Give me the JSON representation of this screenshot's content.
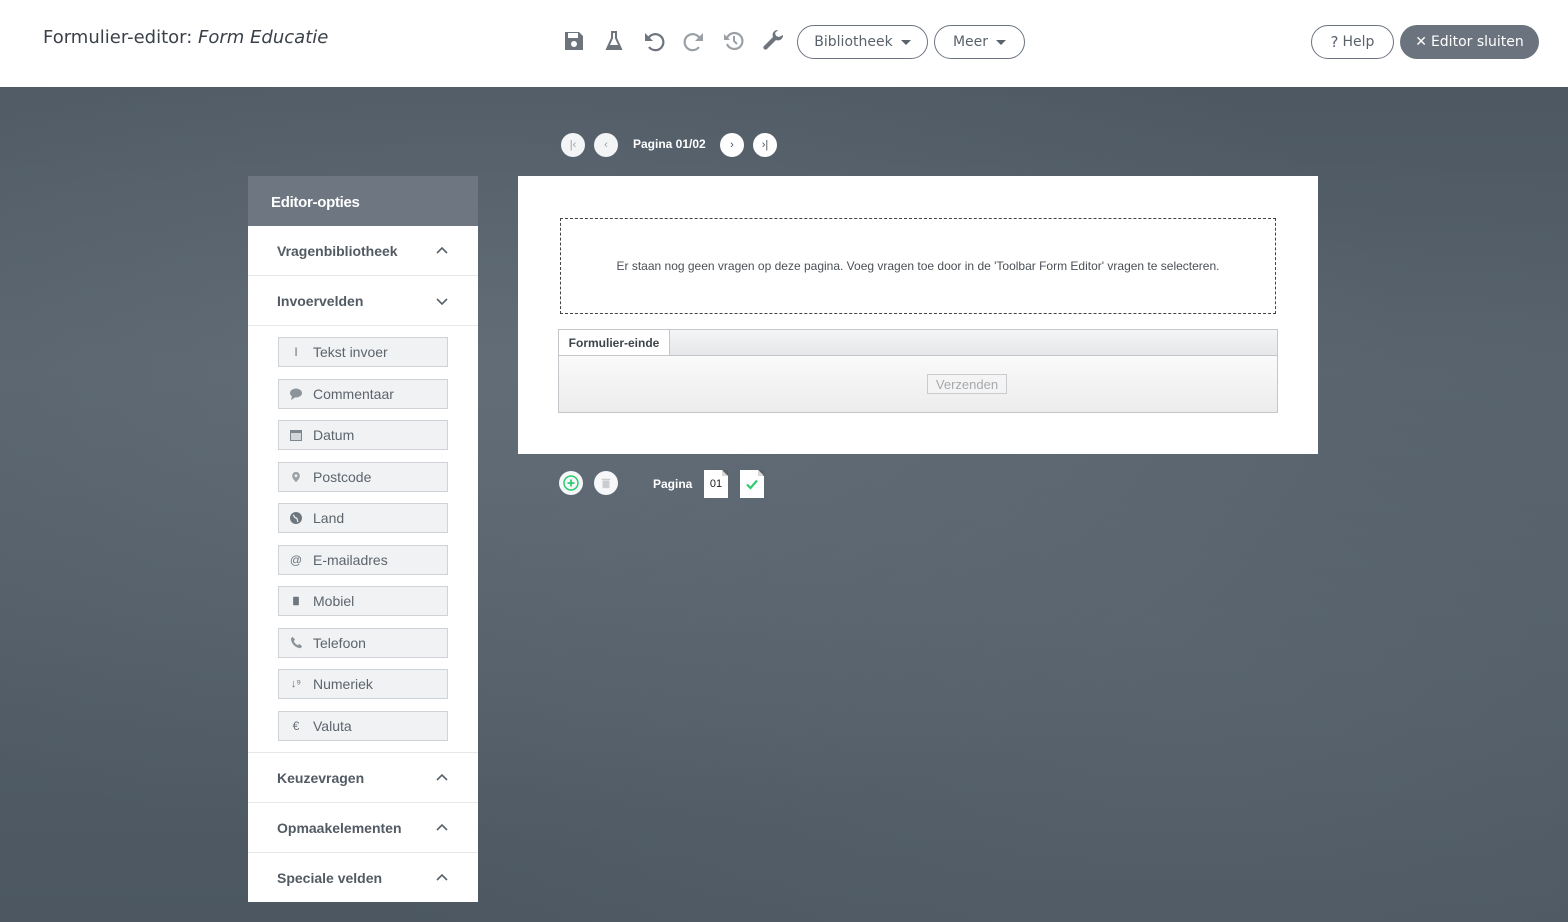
{
  "header": {
    "title_prefix": "Formulier-editor:",
    "form_name": "Form Educatie",
    "toolbar_icons": [
      "save-icon",
      "flask-icon",
      "undo-icon",
      "redo-icon",
      "history-icon",
      "wrench-icon"
    ],
    "library_label": "Bibliotheek",
    "more_label": "Meer",
    "help_label": "Help",
    "close_label": "Editor sluiten"
  },
  "pager": {
    "indicator": "Pagina 01/02"
  },
  "sidebar": {
    "title": "Editor-opties",
    "sections": {
      "library": "Vragenbibliotheek",
      "inputs": "Invoervelden",
      "choices": "Keuzevragen",
      "layout": "Opmaakelementen",
      "special": "Speciale velden"
    },
    "fields": [
      {
        "label": "Tekst invoer",
        "icon": "text-cursor-icon"
      },
      {
        "label": "Commentaar",
        "icon": "comment-icon"
      },
      {
        "label": "Datum",
        "icon": "calendar-icon"
      },
      {
        "label": "Postcode",
        "icon": "map-pin-icon"
      },
      {
        "label": "Land",
        "icon": "globe-icon"
      },
      {
        "label": "E-mailadres",
        "icon": "at-icon"
      },
      {
        "label": "Mobiel",
        "icon": "mobile-icon"
      },
      {
        "label": "Telefoon",
        "icon": "phone-icon"
      },
      {
        "label": "Numeriek",
        "icon": "sort-numeric-icon"
      },
      {
        "label": "Valuta",
        "icon": "euro-icon"
      }
    ]
  },
  "canvas": {
    "empty_message": "Er staan nog geen vragen op deze pagina. Voeg vragen toe door in de 'Toolbar Form Editor' vragen te selecteren.",
    "form_end_label": "Formulier-einde",
    "submit_label": "Verzenden"
  },
  "page_controls": {
    "label": "Pagina",
    "page_number": "01"
  },
  "colors": {
    "header_bg": "#ffffff",
    "sidebar_header": "#6e7781",
    "close_button": "#6b747e",
    "add_green": "#2ecc71"
  }
}
